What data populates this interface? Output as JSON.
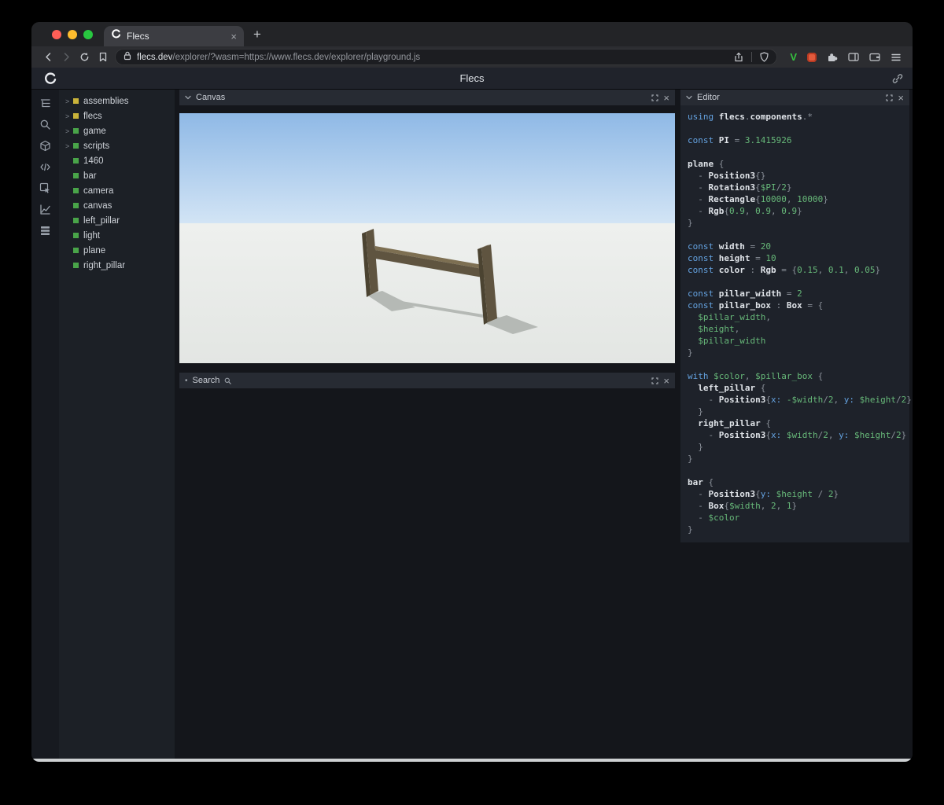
{
  "browser": {
    "tab_title": "Flecs",
    "url_host": "flecs.dev",
    "url_path": "/explorer/?wasm=https://www.flecs.dev/explorer/playground.js",
    "extensions": {
      "vue_label": "V"
    }
  },
  "icons": {
    "close_glyph": "×",
    "plus_glyph": "+",
    "expander_glyph": ">",
    "bullet_glyph": "•"
  },
  "app_header": {
    "title": "Flecs"
  },
  "sidebar_icons": [
    "entity-tree-icon",
    "search-icon",
    "components-cube-icon",
    "code-icon",
    "inspect-icon",
    "chart-icon",
    "data-rows-icon"
  ],
  "tree": {
    "items": [
      {
        "label": "assemblies",
        "expandable": true,
        "color": "#c9b33a"
      },
      {
        "label": "flecs",
        "expandable": true,
        "color": "#c9b33a"
      },
      {
        "label": "game",
        "expandable": true,
        "color": "#49a449"
      },
      {
        "label": "scripts",
        "expandable": true,
        "color": "#49a449"
      },
      {
        "label": "1460",
        "expandable": false,
        "color": "#49a449"
      },
      {
        "label": "bar",
        "expandable": false,
        "color": "#49a449"
      },
      {
        "label": "camera",
        "expandable": false,
        "color": "#49a449"
      },
      {
        "label": "canvas",
        "expandable": false,
        "color": "#49a449"
      },
      {
        "label": "left_pillar",
        "expandable": false,
        "color": "#49a449"
      },
      {
        "label": "light",
        "expandable": false,
        "color": "#49a449"
      },
      {
        "label": "plane",
        "expandable": false,
        "color": "#49a449"
      },
      {
        "label": "right_pillar",
        "expandable": false,
        "color": "#49a449"
      }
    ]
  },
  "panels": {
    "canvas": {
      "title": "Canvas"
    },
    "search": {
      "title": "Search"
    },
    "editor": {
      "title": "Editor"
    }
  },
  "editor": {
    "lines": [
      [
        {
          "c": "k",
          "t": "using "
        },
        {
          "c": "i",
          "t": "flecs"
        },
        {
          "c": "p",
          "t": "."
        },
        {
          "c": "i",
          "t": "components"
        },
        {
          "c": "p",
          "t": ".*"
        }
      ],
      [],
      [
        {
          "c": "k",
          "t": "const "
        },
        {
          "c": "i",
          "t": "PI"
        },
        {
          "c": "p",
          "t": " = "
        },
        {
          "c": "n",
          "t": "3.1415926"
        }
      ],
      [],
      [
        {
          "c": "i",
          "t": "plane"
        },
        {
          "c": "p",
          "t": " {"
        }
      ],
      [
        {
          "c": "p",
          "t": "  - "
        },
        {
          "c": "i",
          "t": "Position3"
        },
        {
          "c": "p",
          "t": "{}"
        }
      ],
      [
        {
          "c": "p",
          "t": "  - "
        },
        {
          "c": "i",
          "t": "Rotation3"
        },
        {
          "c": "p",
          "t": "{"
        },
        {
          "c": "v",
          "t": "$PI"
        },
        {
          "c": "p",
          "t": "/"
        },
        {
          "c": "n",
          "t": "2"
        },
        {
          "c": "p",
          "t": "}"
        }
      ],
      [
        {
          "c": "p",
          "t": "  - "
        },
        {
          "c": "i",
          "t": "Rectangle"
        },
        {
          "c": "p",
          "t": "{"
        },
        {
          "c": "n",
          "t": "10000"
        },
        {
          "c": "p",
          "t": ", "
        },
        {
          "c": "n",
          "t": "10000"
        },
        {
          "c": "p",
          "t": "}"
        }
      ],
      [
        {
          "c": "p",
          "t": "  - "
        },
        {
          "c": "i",
          "t": "Rgb"
        },
        {
          "c": "p",
          "t": "{"
        },
        {
          "c": "n",
          "t": "0.9"
        },
        {
          "c": "p",
          "t": ", "
        },
        {
          "c": "n",
          "t": "0.9"
        },
        {
          "c": "p",
          "t": ", "
        },
        {
          "c": "n",
          "t": "0.9"
        },
        {
          "c": "p",
          "t": "}"
        }
      ],
      [
        {
          "c": "p",
          "t": "}"
        }
      ],
      [],
      [
        {
          "c": "k",
          "t": "const "
        },
        {
          "c": "i",
          "t": "width"
        },
        {
          "c": "p",
          "t": " = "
        },
        {
          "c": "n",
          "t": "20"
        }
      ],
      [
        {
          "c": "k",
          "t": "const "
        },
        {
          "c": "i",
          "t": "height"
        },
        {
          "c": "p",
          "t": " = "
        },
        {
          "c": "n",
          "t": "10"
        }
      ],
      [
        {
          "c": "k",
          "t": "const "
        },
        {
          "c": "i",
          "t": "color"
        },
        {
          "c": "p",
          "t": " : "
        },
        {
          "c": "i",
          "t": "Rgb"
        },
        {
          "c": "p",
          "t": " = {"
        },
        {
          "c": "n",
          "t": "0.15"
        },
        {
          "c": "p",
          "t": ", "
        },
        {
          "c": "n",
          "t": "0.1"
        },
        {
          "c": "p",
          "t": ", "
        },
        {
          "c": "n",
          "t": "0.05"
        },
        {
          "c": "p",
          "t": "}"
        }
      ],
      [],
      [
        {
          "c": "k",
          "t": "const "
        },
        {
          "c": "i",
          "t": "pillar_width"
        },
        {
          "c": "p",
          "t": " = "
        },
        {
          "c": "n",
          "t": "2"
        }
      ],
      [
        {
          "c": "k",
          "t": "const "
        },
        {
          "c": "i",
          "t": "pillar_box"
        },
        {
          "c": "p",
          "t": " : "
        },
        {
          "c": "i",
          "t": "Box"
        },
        {
          "c": "p",
          "t": " = {"
        }
      ],
      [
        {
          "c": "v",
          "t": "  $pillar_width"
        },
        {
          "c": "p",
          "t": ","
        }
      ],
      [
        {
          "c": "v",
          "t": "  $height"
        },
        {
          "c": "p",
          "t": ","
        }
      ],
      [
        {
          "c": "v",
          "t": "  $pillar_width"
        }
      ],
      [
        {
          "c": "p",
          "t": "}"
        }
      ],
      [],
      [
        {
          "c": "k",
          "t": "with "
        },
        {
          "c": "v",
          "t": "$color"
        },
        {
          "c": "p",
          "t": ", "
        },
        {
          "c": "v",
          "t": "$pillar_box"
        },
        {
          "c": "p",
          "t": " {"
        }
      ],
      [
        {
          "c": "i",
          "t": "  left_pillar"
        },
        {
          "c": "p",
          "t": " {"
        }
      ],
      [
        {
          "c": "p",
          "t": "    - "
        },
        {
          "c": "i",
          "t": "Position3"
        },
        {
          "c": "p",
          "t": "{"
        },
        {
          "c": "k",
          "t": "x:"
        },
        {
          "c": "v",
          "t": " -$width"
        },
        {
          "c": "p",
          "t": "/"
        },
        {
          "c": "n",
          "t": "2"
        },
        {
          "c": "p",
          "t": ", "
        },
        {
          "c": "k",
          "t": "y:"
        },
        {
          "c": "v",
          "t": " $height"
        },
        {
          "c": "p",
          "t": "/"
        },
        {
          "c": "n",
          "t": "2"
        },
        {
          "c": "p",
          "t": "}"
        }
      ],
      [
        {
          "c": "p",
          "t": "  }"
        }
      ],
      [
        {
          "c": "i",
          "t": "  right_pillar"
        },
        {
          "c": "p",
          "t": " {"
        }
      ],
      [
        {
          "c": "p",
          "t": "    - "
        },
        {
          "c": "i",
          "t": "Position3"
        },
        {
          "c": "p",
          "t": "{"
        },
        {
          "c": "k",
          "t": "x:"
        },
        {
          "c": "v",
          "t": " $width"
        },
        {
          "c": "p",
          "t": "/"
        },
        {
          "c": "n",
          "t": "2"
        },
        {
          "c": "p",
          "t": ", "
        },
        {
          "c": "k",
          "t": "y:"
        },
        {
          "c": "v",
          "t": " $height"
        },
        {
          "c": "p",
          "t": "/"
        },
        {
          "c": "n",
          "t": "2"
        },
        {
          "c": "p",
          "t": "}"
        }
      ],
      [
        {
          "c": "p",
          "t": "  }"
        }
      ],
      [
        {
          "c": "p",
          "t": "}"
        }
      ],
      [],
      [
        {
          "c": "i",
          "t": "bar"
        },
        {
          "c": "p",
          "t": " {"
        }
      ],
      [
        {
          "c": "p",
          "t": "  - "
        },
        {
          "c": "i",
          "t": "Position3"
        },
        {
          "c": "p",
          "t": "{"
        },
        {
          "c": "k",
          "t": "y:"
        },
        {
          "c": "v",
          "t": " $height"
        },
        {
          "c": "p",
          "t": " / "
        },
        {
          "c": "n",
          "t": "2"
        },
        {
          "c": "p",
          "t": "}"
        }
      ],
      [
        {
          "c": "p",
          "t": "  - "
        },
        {
          "c": "i",
          "t": "Box"
        },
        {
          "c": "p",
          "t": "{"
        },
        {
          "c": "v",
          "t": "$width"
        },
        {
          "c": "p",
          "t": ", "
        },
        {
          "c": "n",
          "t": "2"
        },
        {
          "c": "p",
          "t": ", "
        },
        {
          "c": "n",
          "t": "1"
        },
        {
          "c": "p",
          "t": "}"
        }
      ],
      [
        {
          "c": "p",
          "t": "  - "
        },
        {
          "c": "v",
          "t": "$color"
        }
      ],
      [
        {
          "c": "p",
          "t": "}"
        }
      ]
    ]
  }
}
